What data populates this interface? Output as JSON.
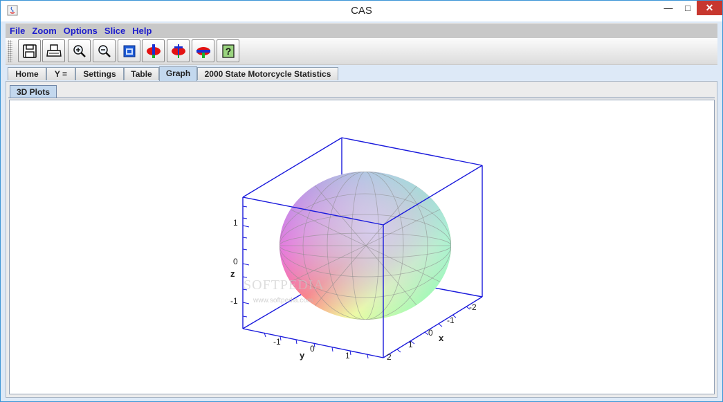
{
  "window": {
    "title": "CAS"
  },
  "title_buttons": {
    "minimize": "—",
    "maximize": "□",
    "close": "✕"
  },
  "menu": [
    "File",
    "Zoom",
    "Options",
    "Slice",
    "Help"
  ],
  "toolbar": [
    {
      "name": "save-icon"
    },
    {
      "name": "print-icon"
    },
    {
      "name": "zoom-in-icon"
    },
    {
      "name": "zoom-out-icon"
    },
    {
      "name": "window-icon"
    },
    {
      "name": "slice-vertical-icon"
    },
    {
      "name": "slice-split-icon"
    },
    {
      "name": "slice-horizontal-icon"
    },
    {
      "name": "help-icon",
      "glyph": "?"
    }
  ],
  "tabs": [
    "Home",
    "Y =",
    "Settings",
    "Table",
    "Graph",
    "2000 State Motorcycle Statistics"
  ],
  "active_tab": "Graph",
  "subtabs": [
    "3D Plots"
  ],
  "plot": {
    "z_ticks": [
      "1",
      "0",
      "-1"
    ],
    "z_label": "z",
    "y_ticks": [
      "-1",
      "0",
      "1"
    ],
    "y_label": "y",
    "x_ticks": [
      "-2",
      "-1",
      "0",
      "1",
      "2"
    ],
    "x_label": "x",
    "box_color": "#1a1adc"
  },
  "watermark": {
    "main": "SOFTPEDIA",
    "sub": "www.softpedia.com"
  }
}
